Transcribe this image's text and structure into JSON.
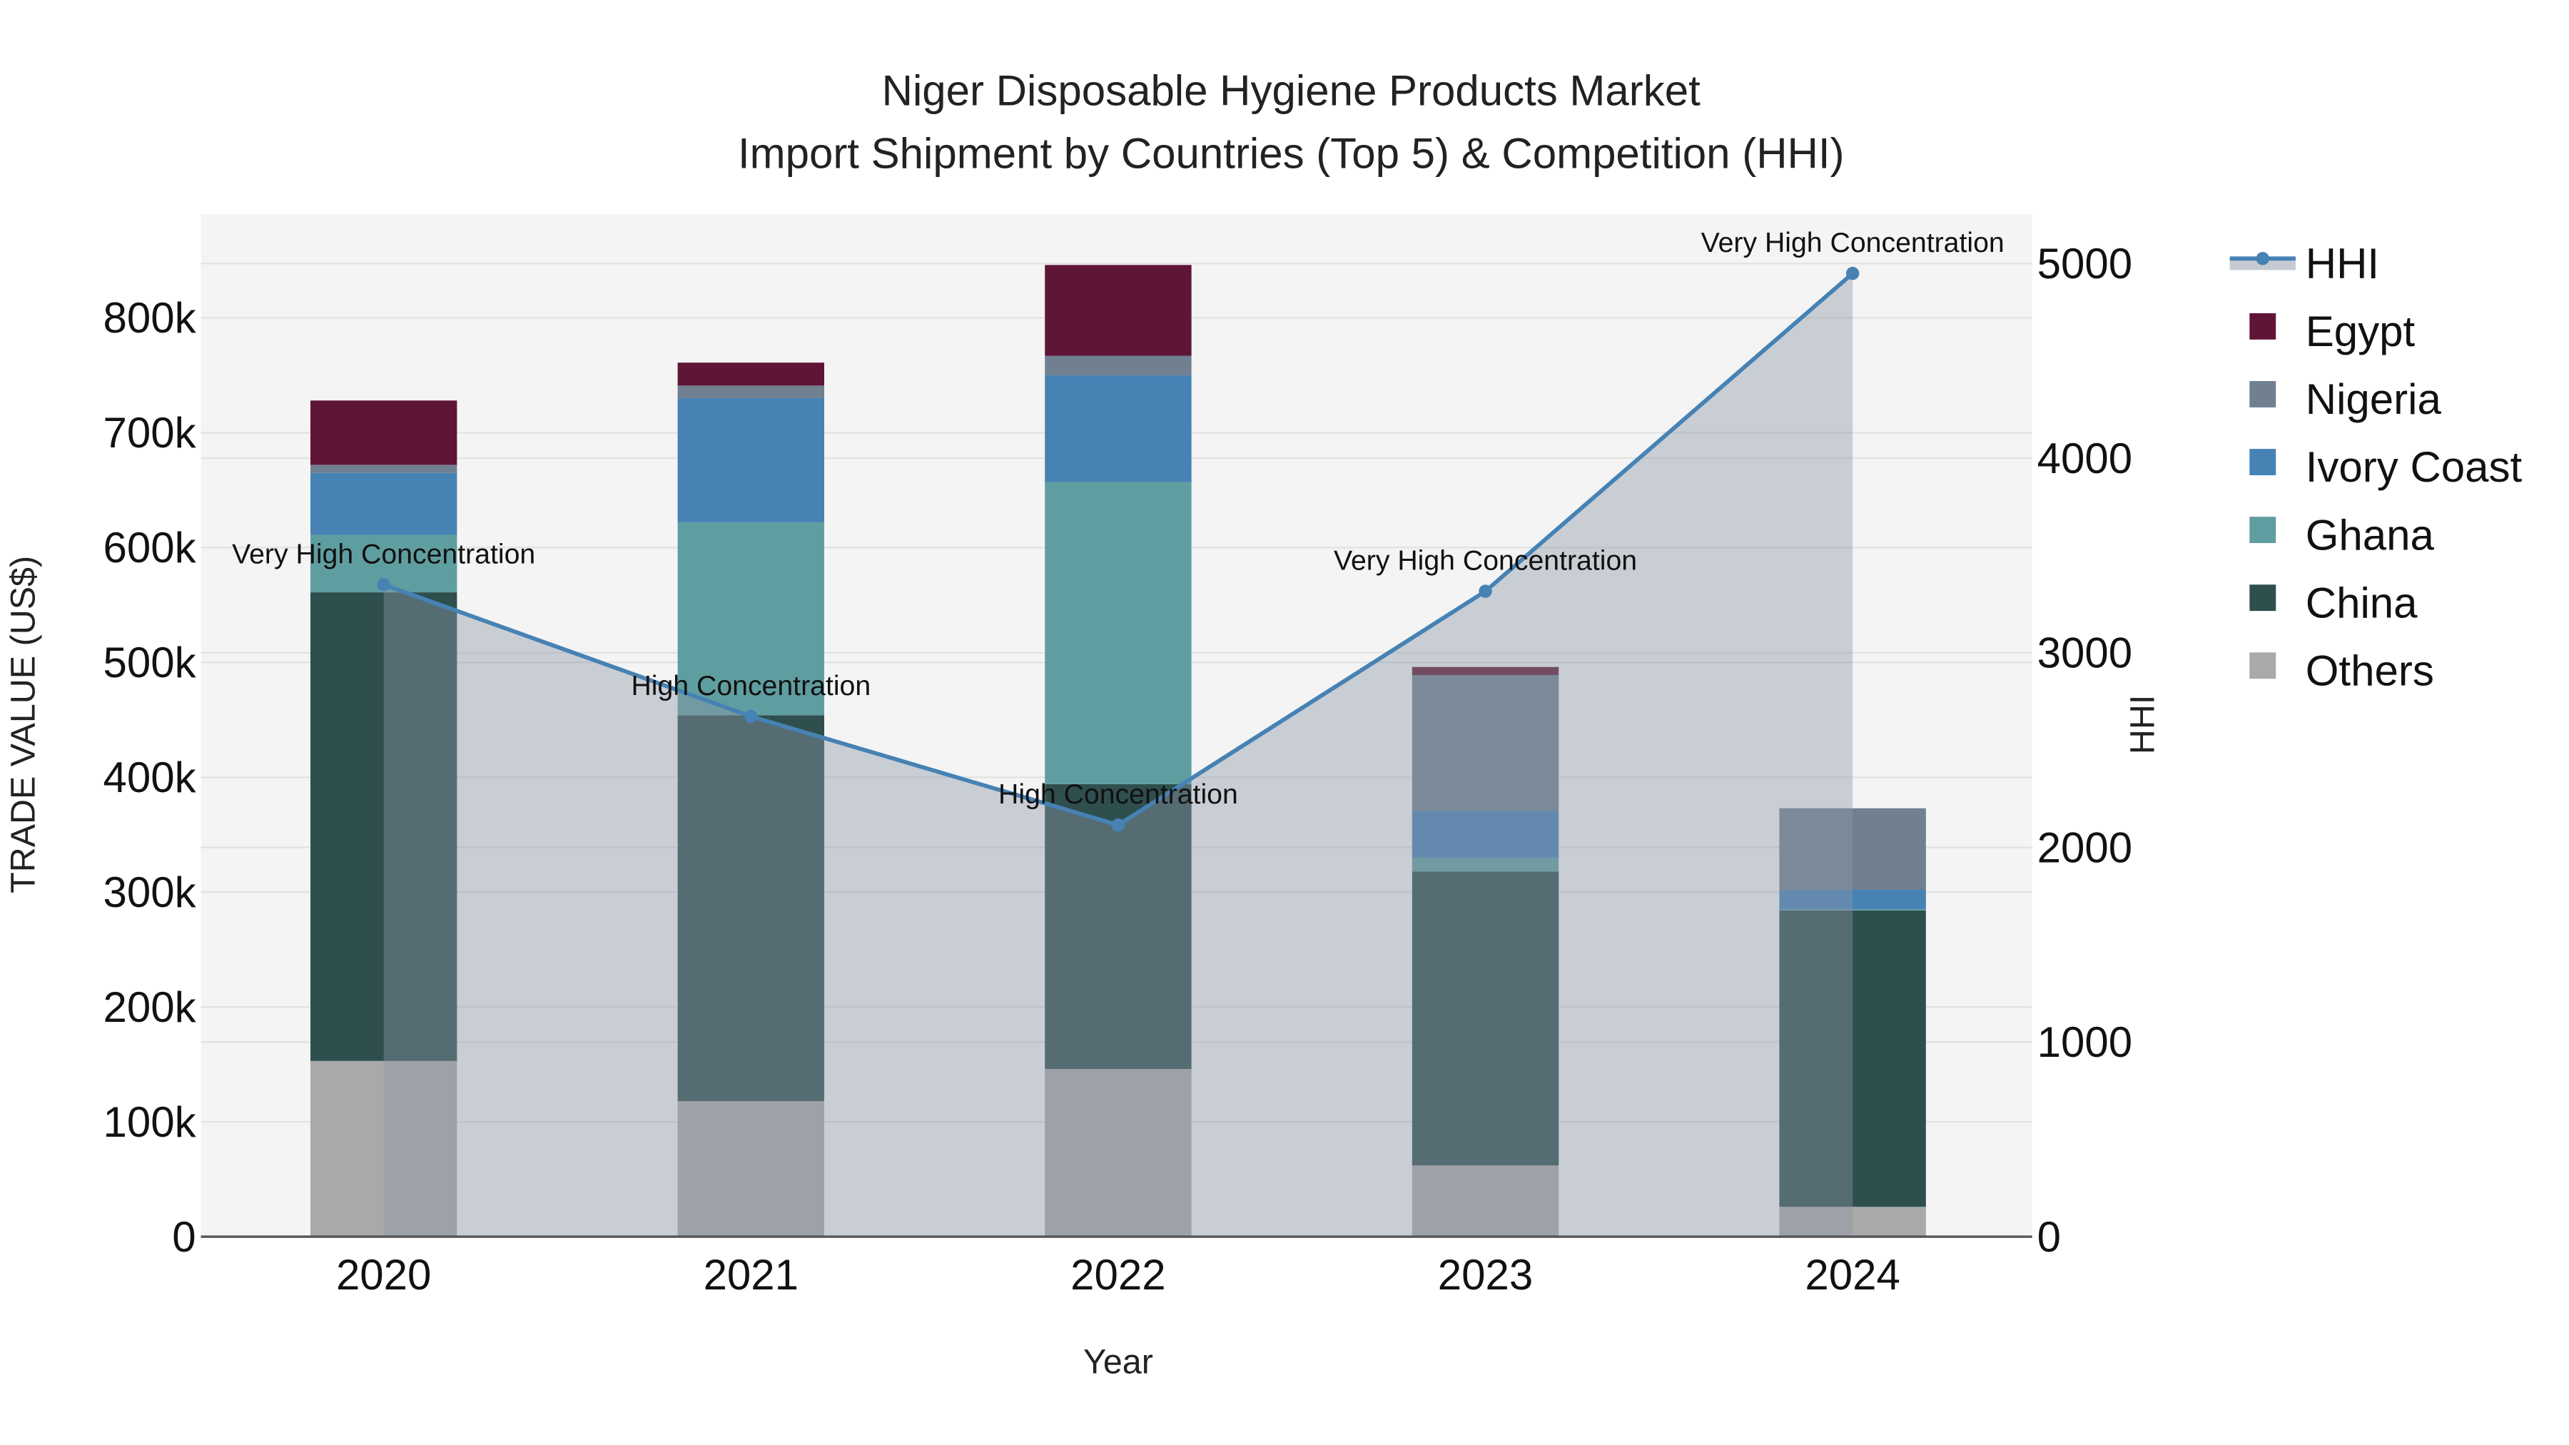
{
  "chart_data": {
    "type": "bar",
    "stacked": true,
    "title_line1": "Niger Disposable Hygiene Products Market",
    "title_line2": "Import Shipment by Countries (Top 5) & Competition (HHI)",
    "xlabel": "Year",
    "ylabel": "TRADE VALUE (US$)",
    "y2label": "HHI",
    "categories": [
      "2020",
      "2021",
      "2022",
      "2023",
      "2024"
    ],
    "ylim": [
      0,
      890000
    ],
    "y_ticks": [
      0,
      100000,
      200000,
      300000,
      400000,
      500000,
      600000,
      700000,
      800000
    ],
    "y_tick_labels": [
      "0",
      "100k",
      "200k",
      "300k",
      "400k",
      "500k",
      "600k",
      "700k",
      "800k"
    ],
    "y2lim": [
      0,
      5260
    ],
    "y2_ticks": [
      0,
      1000,
      2000,
      3000,
      4000,
      5000
    ],
    "y2_tick_labels": [
      "0",
      "1000",
      "2000",
      "3000",
      "4000",
      "5000"
    ],
    "grid": true,
    "legend_position": "right",
    "series": [
      {
        "name": "Others",
        "color": "#a9a9a9",
        "values": [
          153000,
          118000,
          146000,
          62000,
          26000
        ]
      },
      {
        "name": "China",
        "color": "#2f4f4f",
        "values": [
          408000,
          336000,
          248000,
          256000,
          258000
        ]
      },
      {
        "name": "Ghana",
        "color": "#5f9ea0",
        "values": [
          50000,
          168000,
          263000,
          12000,
          1000
        ]
      },
      {
        "name": "Ivory Coast",
        "color": "#4682b4",
        "values": [
          54000,
          108000,
          93000,
          41000,
          17000
        ]
      },
      {
        "name": "Nigeria",
        "color": "#708090",
        "values": [
          7000,
          11000,
          17000,
          118000,
          71000
        ]
      },
      {
        "name": "Egypt",
        "color": "#5f1536",
        "values": [
          56000,
          20000,
          79000,
          7000,
          0
        ]
      }
    ],
    "hhi": {
      "name": "HHI",
      "color": "#4682b4",
      "values": [
        3350,
        2673,
        2115,
        3316,
        4949
      ],
      "labels": [
        "Very High Concentration",
        "High Concentration",
        "High Concentration",
        "Very High Concentration",
        "Very High Concentration"
      ]
    },
    "legend_order": [
      "HHI",
      "Egypt",
      "Nigeria",
      "Ivory Coast",
      "Ghana",
      "China",
      "Others"
    ]
  }
}
